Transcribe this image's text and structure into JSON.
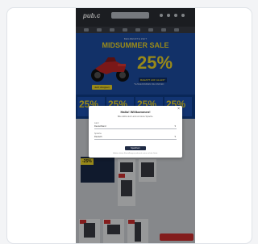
{
  "site": {
    "logo": "pub.c"
  },
  "hero": {
    "kicker": "BEGRENZTE ZEIT",
    "title": "MIDSUMMER SALE",
    "percent": "25%",
    "subline": "RABATT AUF ALLES*",
    "fineprint": "*AUSGENOMMEN DIE MARKEN",
    "cta": "Jetzt shoppen"
  },
  "tiles": [
    {
      "value": "25%"
    },
    {
      "value": "25%"
    },
    {
      "value": "25%"
    },
    {
      "value": "25%"
    }
  ],
  "promo": {
    "badge": "-25%"
  },
  "modal": {
    "close": "×",
    "title": "Hallo! Willkommen!",
    "text": "Bitte wähle dein Land und deine Sprache.",
    "country_label": "Land",
    "country_value": "Deutschland",
    "language_label": "Sprache",
    "language_value": "Deutsch",
    "save_label": "Speichern",
    "footer": "Ändere deine Einstellungen jederzeit unten auf der Seite."
  },
  "colors": {
    "accent": "#f5dd2b",
    "hero_blue": "#1d4fa8",
    "sale_red": "#d32f2f",
    "button_dark": "#1f2a44"
  }
}
